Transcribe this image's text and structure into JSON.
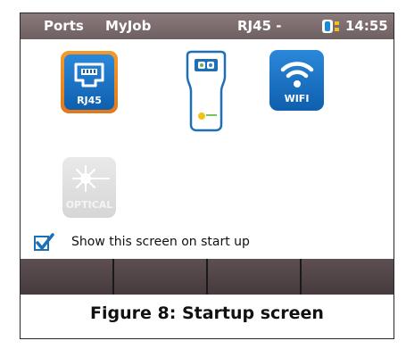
{
  "statusbar": {
    "ports_label": "Ports",
    "myjob_label": "MyJob",
    "port_label": "RJ45 -",
    "time": "14:55",
    "battery_icon": "battery-icon"
  },
  "tiles": {
    "rj45_label": "RJ45",
    "wifi_label": "WIFI",
    "optical_label": "OPTICAL",
    "rj45_icon": "ethernet-port-icon",
    "wifi_icon": "wifi-icon",
    "device_icon": "remote-device-icon",
    "optical_icon": "laser-burst-icon"
  },
  "startup": {
    "checkbox_label": "Show this screen on start up",
    "checked": true
  },
  "softkeys": [
    "",
    "",
    "",
    ""
  ],
  "caption": "Figure 8: Startup screen",
  "colors": {
    "accent_blue": "#1f6fb6",
    "orange": "#f29b2c",
    "statusbar": "#7d6e70",
    "softkey": "#52464a"
  }
}
